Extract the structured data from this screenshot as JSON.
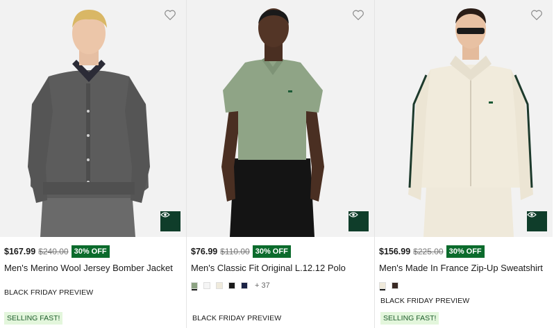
{
  "products": [
    {
      "price": "$167.99",
      "old_price": "$240.00",
      "discount": "30% OFF",
      "name": "Men's Merino Wool Jersey Bomber Jacket",
      "promo": "BLACK FRIDAY PREVIEW",
      "badge": "SELLING FAST!",
      "swatches": [],
      "more_colors": ""
    },
    {
      "price": "$76.99",
      "old_price": "$110.00",
      "discount": "30% OFF",
      "name": "Men's Classic Fit Original L.12.12 Polo",
      "promo": "BLACK FRIDAY PREVIEW",
      "badge": "",
      "swatches": [
        "#8da383",
        "#f5f5f5",
        "#efeadc",
        "#1a1a1a",
        "#1b2346"
      ],
      "more_colors": "+ 37"
    },
    {
      "price": "$156.99",
      "old_price": "$225.00",
      "discount": "30% OFF",
      "name": "Men's Made In France Zip-Up Sweatshirt",
      "promo": "BLACK FRIDAY PREVIEW",
      "badge": "SELLING FAST!",
      "swatches": [
        "#efe9da",
        "#3a2a25"
      ],
      "more_colors": ""
    }
  ],
  "colors": {
    "discount_bg": "#0b6b2c",
    "quickview_bg": "#0f3d2a",
    "badge_bg": "#e3f6dc"
  },
  "icons": {
    "wishlist": "heart-outline-icon",
    "quickview": "eye-icon"
  }
}
